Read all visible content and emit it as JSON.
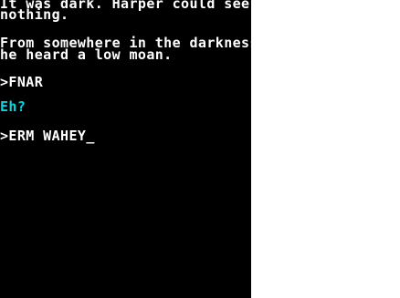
{
  "text_window": {
    "narrative": [
      "It was dark. Harper could see",
      "nothing.",
      "From somewhere in the darkness,",
      "he heard a low moan."
    ],
    "commands": [
      ">FNAR",
      "Eh?",
      ">ERM WAHEY"
    ],
    "cursor": "_"
  },
  "colors": {
    "background": "#000000",
    "text": "#ffffff",
    "response": "#00d8e0"
  }
}
